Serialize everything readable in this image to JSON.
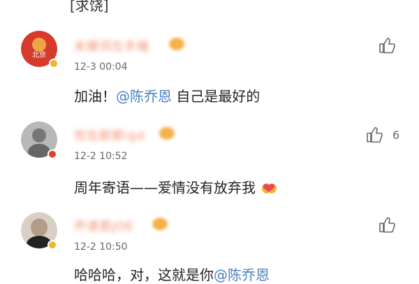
{
  "top": {
    "text": "[求饶]"
  },
  "comments": [
    {
      "username": "未键词左手缝",
      "time": "12-3 00:04",
      "text_prefix": "加油！",
      "mention": "@陈乔恩",
      "text_suffix": " 自己是最好的",
      "likes": "",
      "avatar_color": "#d73a2c",
      "badge_color": "#f2b233"
    },
    {
      "username": "忧在剧那igd",
      "time": "12-2 10:52",
      "text_prefix": "周年寄语——爱情没有放弃我",
      "mention": "",
      "text_suffix": "",
      "likes": "6",
      "avatar_color": "#8a8a8a",
      "badge_color": "#e0402f"
    },
    {
      "username": "乔请恩JOE",
      "time": "12-2 10:50",
      "text_prefix": "哈哈哈，对，这就是你",
      "mention": "@陈乔恩",
      "text_suffix": "",
      "likes": "",
      "avatar_color": "#c9b9a8",
      "badge_color": "#f2b233"
    }
  ]
}
